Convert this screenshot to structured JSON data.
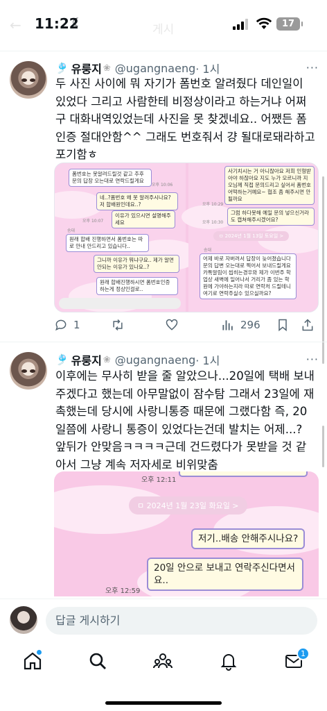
{
  "status_bar": {
    "time": "11:22",
    "moon_icon": "☾",
    "faded_title": "게시",
    "battery": "17"
  },
  "posts": [
    {
      "name": "유룽지",
      "name_prefix_emoji": "🎐",
      "name_suffix_emoji": "❀",
      "handle": "@ugangnaeng",
      "time": "· 1시",
      "more": "···",
      "text": "두 사진 사이에 뭐 자기가 폼번호 알려줬다 데인일이 있었다 그리고 사람한테 비정상이라고 하는거냐 어쩌구 대화내역있었는데 사진을 못 찾겠네요.. 어쨌든 폼인증 절대안함^^ 그래도 번호줘서 걍 될대로돼라하고 포기함ㅎ",
      "media": {
        "left_bubbles": [
          "폼번호는 못알려드릴것 같고 추후 문의 답장 오는대로 연락드릴게요",
          "네..?폼번호 왜 못 알려주시나요? 저 합배원인데요..?",
          "이유가 있으시면 설명해주세요",
          "원래 합배 진행하면서 폼번호는 따로 안내 안드리고 있습니다..",
          "그니까 이유가 뭐냐구요.. 제가 알면 안되는 이유가 있나요..?",
          "원래 합배진행하시면 폼번호인증하는게 정상인걸로.."
        ],
        "left_small": [
          "오후 10:06",
          "오후 10:07",
          "송대"
        ],
        "right_bubbles": [
          "사기치시는 거 아니잖아요 저희 인형받아야 하잖아요 지도 누가 모르니까 지오님께 직접 문의드리고 싶어서 폼번호 어떡하는거예요~ 협조 좀 해주시면 안될까요",
          "그럼 하다못해 예일 문의 넣으신거라도 캡쳐해주시겠어요?",
          "어제 바로 자버려서 답장이 늦어졌습니다 문의 답변 오는대로 찍어서 보내드릴게요 카톡알림이 씹히는경우와 제가 이번주 학업상 새벽에 일어나서 거리가 좀 있는 학원에 가야하는지라 따로 연락처 드릴테니 여기로 연락주실수 있으실까요?"
        ],
        "right_small": [
          "오후 10:29",
          "오후 10:30",
          "송대"
        ],
        "right_date": "ㅁ 2024년 1월 13일 토요일 >"
      },
      "replies": "1",
      "retweets": "",
      "likes": "",
      "views": "296"
    },
    {
      "name": "유룽지",
      "name_prefix_emoji": "🎐",
      "name_suffix_emoji": "❀",
      "handle": "@ugangnaeng",
      "time": "· 1시",
      "more": "···",
      "text": "이후에는 무사히 받을 줄 알았으나...20일에 택배 보내주겠다고 했는데 아무말없이 잠수탐 그래서 23일에 재촉했는데 당시에 사랑니통증 때문에 그랬다함 즉, 20일쯤에 사랑니 통증이 있었다는건데 발치는 어제...? 앞뒤가 안맞음ㅋㅋㅋㅋ근데 건드렸다가 못받을 것 같아서 그냥 계속 저자세로 비위맞춤",
      "media": {
        "time_top": "오후 12:11",
        "date_chip": "ㅁ 2024년 1월 23일 화요일 >",
        "bubble1": "저기..배송 안해주시나요?",
        "bubble2": "20일 안으로 보내고 연락주신다면서요..",
        "time_bottom": "오후 12:59"
      }
    }
  ],
  "reply_bar": {
    "placeholder": "답글 게시하기"
  },
  "tab_bar": {
    "messages_badge": "1"
  }
}
